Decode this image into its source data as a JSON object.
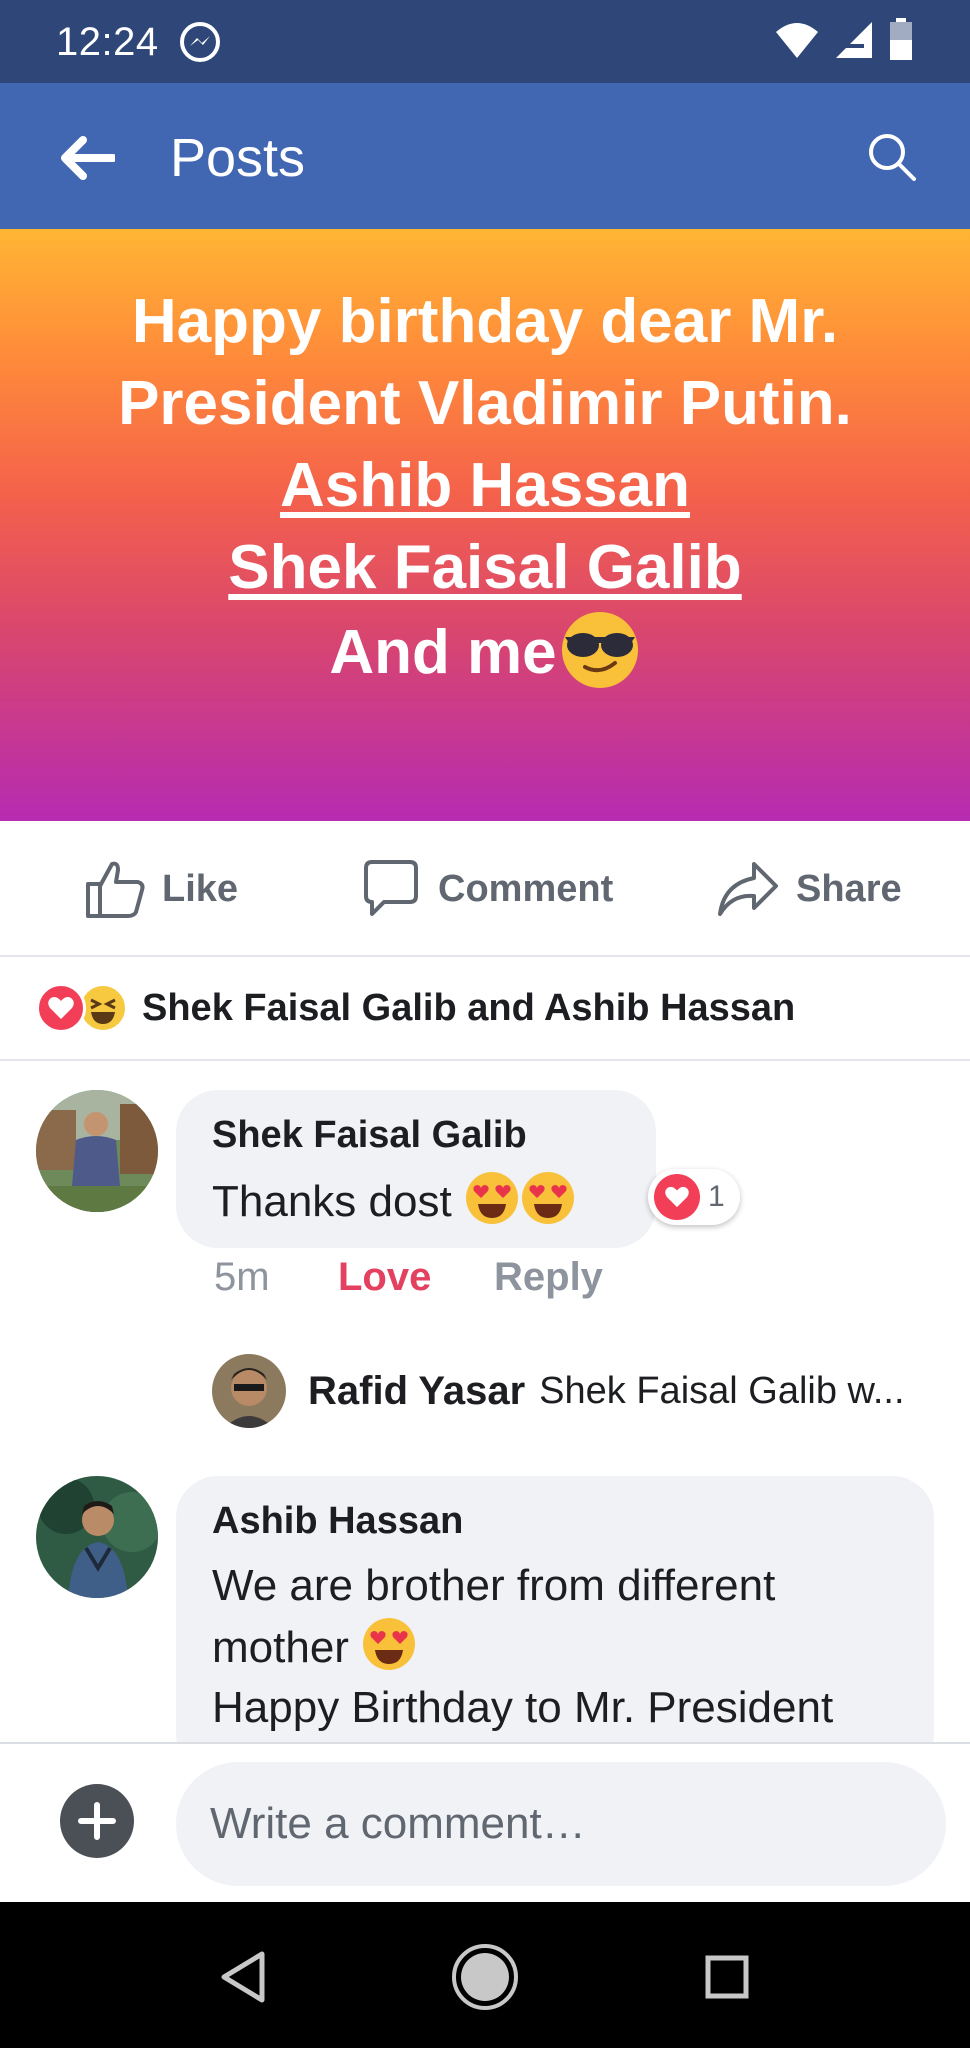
{
  "status_bar": {
    "time": "12:24"
  },
  "app_bar": {
    "title": "Posts"
  },
  "post": {
    "line1": "Happy birthday dear Mr.",
    "line2": "President Vladimir Putin.",
    "mention1": "Ashib Hassan",
    "mention2": "Shek Faisal Galib",
    "line5": "And me",
    "background_colors": [
      "#ffb534",
      "#f4614b",
      "#b62bb1"
    ]
  },
  "actions": {
    "like": "Like",
    "comment": "Comment",
    "share": "Share"
  },
  "reactions": {
    "text": "Shek Faisal Galib and Ashib Hassan"
  },
  "comments": [
    {
      "name": "Shek Faisal Galib",
      "text": "Thanks dost",
      "love_count": "1",
      "time": "5m",
      "love_label": "Love",
      "reply_label": "Reply",
      "reply_preview": {
        "name": "Rafid Yasar",
        "text": "Shek Faisal Galib w..."
      }
    },
    {
      "name": "Ashib Hassan",
      "line1": "We are brother from different",
      "line2": "mother",
      "line3": "Happy Birthday to Mr. President"
    }
  ],
  "composer": {
    "placeholder": "Write a comment…"
  },
  "colors": {
    "facebook_blue": "#4267b2",
    "status_blue": "#2f4679",
    "love_red": "#f33e58"
  }
}
